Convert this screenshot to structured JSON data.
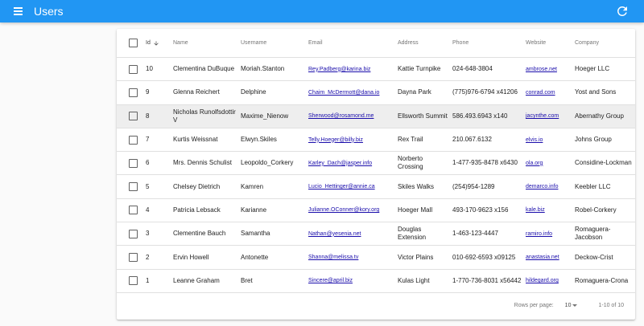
{
  "header": {
    "title": "Users",
    "menu_icon": "menu-icon",
    "refresh_icon": "refresh-icon",
    "color": "#2196f3"
  },
  "table": {
    "columns": [
      "Id",
      "Name",
      "Username",
      "Email",
      "Address",
      "Phone",
      "Website",
      "Company"
    ],
    "sort": {
      "column": "Id",
      "direction": "desc"
    },
    "rows": [
      {
        "id": "10",
        "name": "Clementina DuBuque",
        "username": "Moriah.Stanton",
        "email": "Rey.Padberg@karina.biz",
        "address": "Kattie Turnpike",
        "phone": "024-648-3804",
        "website": "ambrose.net",
        "company": "Hoeger LLC"
      },
      {
        "id": "9",
        "name": "Glenna Reichert",
        "username": "Delphine",
        "email": "Chaim_McDermott@dana.io",
        "address": "Dayna Park",
        "phone": "(775)976-6794 x41206",
        "website": "conrad.com",
        "company": "Yost and Sons"
      },
      {
        "id": "8",
        "name": "Nicholas Runolfsdottir V",
        "username": "Maxime_Nienow",
        "email": "Sherwood@rosamond.me",
        "address": "Ellsworth Summit",
        "phone": "586.493.6943 x140",
        "website": "jacynthe.com",
        "company": "Abernathy Group"
      },
      {
        "id": "7",
        "name": "Kurtis Weissnat",
        "username": "Elwyn.Skiles",
        "email": "Telly.Hoeger@billy.biz",
        "address": "Rex Trail",
        "phone": "210.067.6132",
        "website": "elvis.io",
        "company": "Johns Group"
      },
      {
        "id": "6",
        "name": "Mrs. Dennis Schulist",
        "username": "Leopoldo_Corkery",
        "email": "Karley_Dach@jasper.info",
        "address": "Norberto Crossing",
        "phone": "1-477-935-8478 x6430",
        "website": "ola.org",
        "company": "Considine-Lockman"
      },
      {
        "id": "5",
        "name": "Chelsey Dietrich",
        "username": "Kamren",
        "email": "Lucio_Hettinger@annie.ca",
        "address": "Skiles Walks",
        "phone": "(254)954-1289",
        "website": "demarco.info",
        "company": "Keebler LLC"
      },
      {
        "id": "4",
        "name": "Patricia Lebsack",
        "username": "Karianne",
        "email": "Julianne.OConner@kory.org",
        "address": "Hoeger Mall",
        "phone": "493-170-9623 x156",
        "website": "kale.biz",
        "company": "Robel-Corkery"
      },
      {
        "id": "3",
        "name": "Clementine Bauch",
        "username": "Samantha",
        "email": "Nathan@yesenia.net",
        "address": "Douglas Extension",
        "phone": "1-463-123-4447",
        "website": "ramiro.info",
        "company": "Romaguera-Jacobson"
      },
      {
        "id": "2",
        "name": "Ervin Howell",
        "username": "Antonette",
        "email": "Shanna@melissa.tv",
        "address": "Victor Plains",
        "phone": "010-692-6593 x09125",
        "website": "anastasia.net",
        "company": "Deckow-Crist"
      },
      {
        "id": "1",
        "name": "Leanne Graham",
        "username": "Bret",
        "email": "Sincere@april.biz",
        "address": "Kulas Light",
        "phone": "1-770-736-8031 x56442",
        "website": "hildegard.org",
        "company": "Romaguera-Crona"
      }
    ],
    "highlighted_row": "8"
  },
  "footer": {
    "rows_per_page_label": "Rows per page:",
    "rows_per_page_value": "10",
    "range": "1-10 of 10"
  }
}
